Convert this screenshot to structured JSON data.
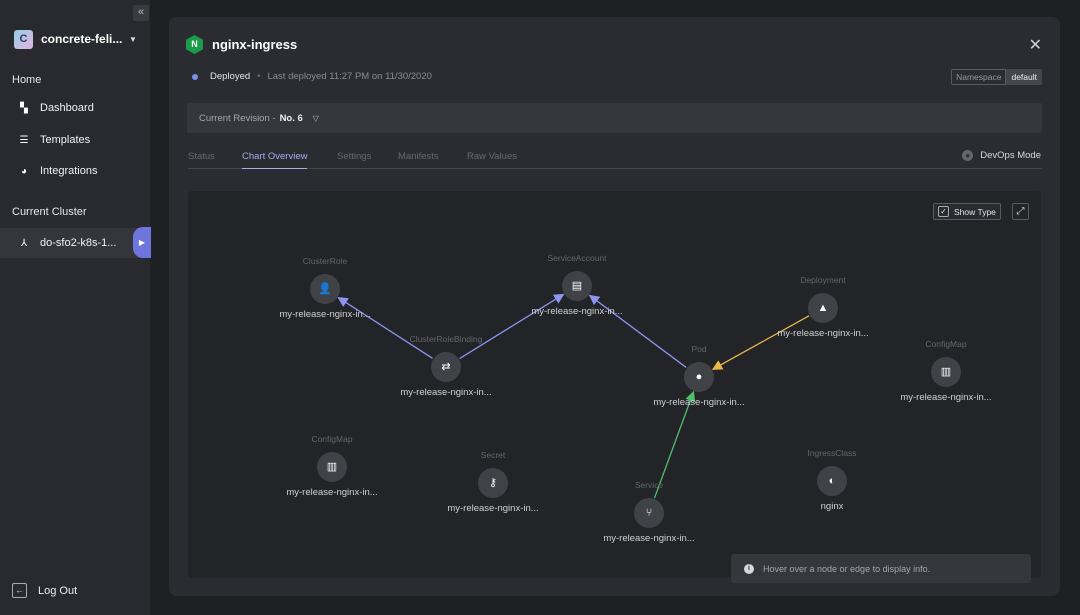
{
  "sidebar": {
    "project": {
      "initial": "C",
      "name": "concrete-feli..."
    },
    "home_label": "Home",
    "items": [
      {
        "label": "Dashboard",
        "icon": "dashboard-icon"
      },
      {
        "label": "Templates",
        "icon": "templates-icon"
      },
      {
        "label": "Integrations",
        "icon": "integrations-icon"
      }
    ],
    "cluster_label": "Current Cluster",
    "cluster": {
      "name": "do-sfo2-k8s-1...",
      "icon": "cluster-icon"
    },
    "logout_label": "Log Out"
  },
  "modal": {
    "title": "nginx-ingress",
    "logo_letter": "N",
    "status": "Deployed",
    "last_deployed": "Last deployed 11:27 PM on 11/30/2020",
    "namespace_label": "Namespace",
    "namespace_value": "default",
    "revision_label": "Current Revision -",
    "revision_value": "No. 6",
    "tabs": [
      "Status",
      "Chart Overview",
      "Settings",
      "Manifests",
      "Raw Values"
    ],
    "active_tab": "Chart Overview",
    "devops_label": "DevOps Mode",
    "show_type_label": "Show Type",
    "show_type_checked": true,
    "hover_info": "Hover over a node or edge to display info."
  },
  "graph": {
    "nodes": [
      {
        "id": "clusterrole",
        "type": "ClusterRole",
        "name": "my-release-nginx-in...",
        "icon": "user-icon"
      },
      {
        "id": "clusterrolebinding",
        "type": "ClusterRoleBinding",
        "name": "my-release-nginx-in...",
        "icon": "swap-icon"
      },
      {
        "id": "serviceaccount",
        "type": "ServiceAccount",
        "name": "my-release-nginx-in...",
        "icon": "toolbox-icon"
      },
      {
        "id": "pod",
        "type": "Pod",
        "name": "my-release-nginx-in...",
        "icon": "circle-icon"
      },
      {
        "id": "deployment",
        "type": "Deployment",
        "name": "my-release-nginx-in...",
        "icon": "shapes-icon"
      },
      {
        "id": "configmap1",
        "type": "ConfigMap",
        "name": "my-release-nginx-in...",
        "icon": "map-icon"
      },
      {
        "id": "configmap2",
        "type": "ConfigMap",
        "name": "my-release-nginx-in...",
        "icon": "map-icon"
      },
      {
        "id": "secret",
        "type": "Secret",
        "name": "my-release-nginx-in...",
        "icon": "key-icon"
      },
      {
        "id": "ingressclass",
        "type": "IngressClass",
        "name": "nginx",
        "icon": "contrast-icon"
      },
      {
        "id": "service",
        "type": "Service",
        "name": "my-release-nginx-in...",
        "icon": "fork-icon"
      }
    ],
    "edges": [
      {
        "from": "clusterrolebinding",
        "to": "clusterrole",
        "color": "#8d95f0"
      },
      {
        "from": "clusterrolebinding",
        "to": "serviceaccount",
        "color": "#8d95f0"
      },
      {
        "from": "pod",
        "to": "serviceaccount",
        "color": "#8d95f0"
      },
      {
        "from": "deployment",
        "to": "pod",
        "color": "#e8b84a"
      },
      {
        "from": "service",
        "to": "pod",
        "color": "#4ebf6a"
      }
    ]
  }
}
